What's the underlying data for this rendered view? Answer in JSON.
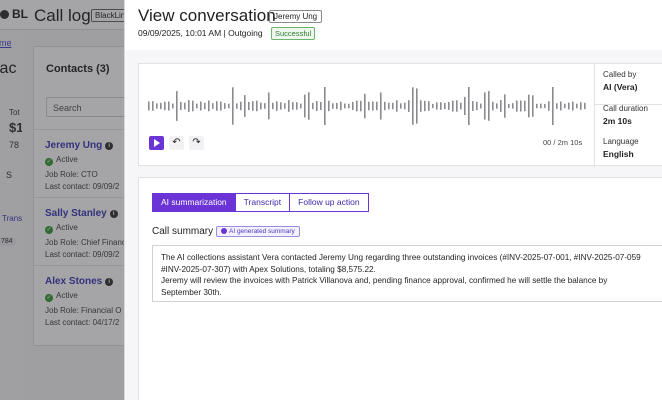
{
  "background": {
    "logo": "BL",
    "breadcrumb": "ome",
    "big_title": "lac",
    "page_title": "Call log",
    "page_tag": "BlackLine",
    "left_snippets": [
      "Tot",
      "$1",
      "78",
      "S",
      "Trans",
      "784"
    ],
    "contacts": {
      "title": "Contacts (3)",
      "search_placeholder": "Search",
      "items": [
        {
          "name": "Jeremy Ung",
          "status": "Active",
          "job_role": "Job Role: CTO",
          "last_contact": "Last contact: 09/09/2"
        },
        {
          "name": "Sally Stanley",
          "status": "Active",
          "job_role": "Job Role: Chief Financ",
          "last_contact": "Last contact: 09/09/2"
        },
        {
          "name": "Alex Stones",
          "status": "Active",
          "job_role": "Job Role: Financial O",
          "last_contact": "Last contact: 04/17/2"
        }
      ]
    }
  },
  "drawer": {
    "title": "View conversation",
    "contact_tag": "Jeremy Ung",
    "meta": "09/09/2025, 10:01 AM | Outgoing",
    "status_badge": "Successful",
    "audio": {
      "time": "00 / 2m 10s",
      "playback_progress": 0,
      "icons": {
        "play": "play-icon",
        "rewind": "rewind-icon",
        "forward": "forward-icon"
      }
    },
    "details": [
      {
        "label": "Called by",
        "value": "AI (Vera)"
      },
      {
        "label": "Call duration",
        "value": "2m 10s"
      },
      {
        "label": "Language",
        "value": "English"
      }
    ],
    "tabs": [
      "AI summarization",
      "Transcript",
      "Follow up action"
    ],
    "active_tab": 0,
    "summary_title": "Call summary",
    "ai_badge": "AI generated summary",
    "summary_lines": [
      "The AI collections assistant Vera contacted Jeremy Ung regarding three outstanding invoices (#INV-2025-07-001, #INV-2025-07-059",
      "#INV-2025-07-307) with Apex Solutions, totaling $8,575.22.",
      "Jeremy will review the invoices with Patrick Villanova and, pending finance approval, confirmed he will settle the balance by",
      "September 30th."
    ],
    "colors": {
      "accent": "#6b34d6",
      "success": "#2d7a2d",
      "link": "#3b38b8"
    }
  }
}
